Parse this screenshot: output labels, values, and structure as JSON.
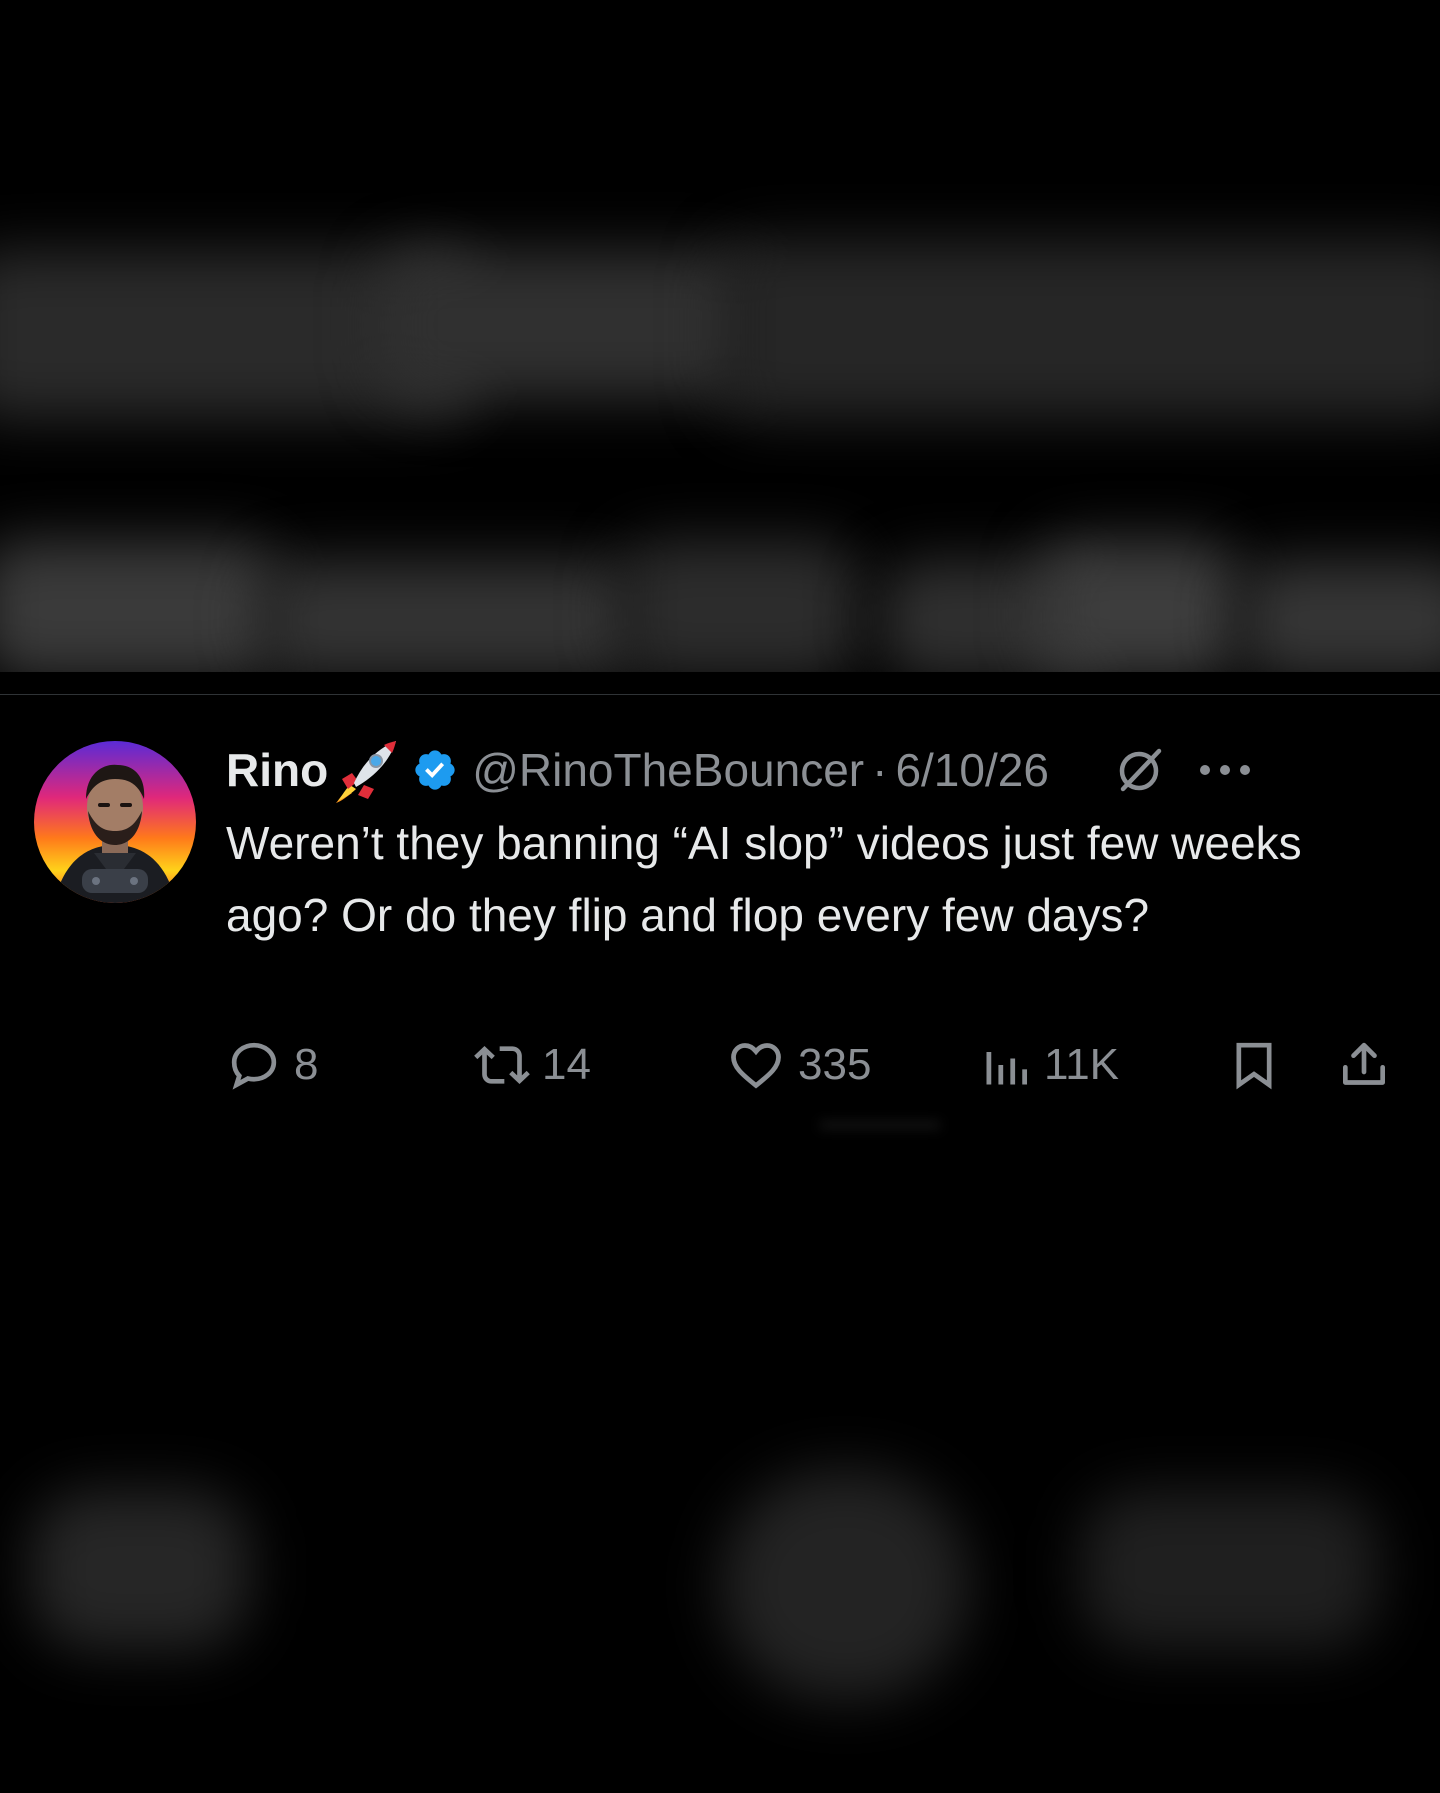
{
  "tweet": {
    "display_name": "Rino",
    "handle": "@RinoTheBouncer",
    "separator": "·",
    "date": "6/10/26",
    "text": "Weren’t they banning “AI slop” videos just few weeks ago? Or do they flip and flop every few days?",
    "icons": {
      "name_badge": "rocket-emoji-icon",
      "verified": "verified-badge-icon",
      "grok": "grok-icon",
      "more": "more-icon"
    },
    "actions": {
      "replies": "8",
      "reposts": "14",
      "likes": "335",
      "views": "11K"
    }
  },
  "colors": {
    "background": "#000000",
    "text_primary": "#e7e9ea",
    "text_secondary": "#8b8f94",
    "verified_blue": "#1d9bf0",
    "divider": "#2f3336"
  }
}
